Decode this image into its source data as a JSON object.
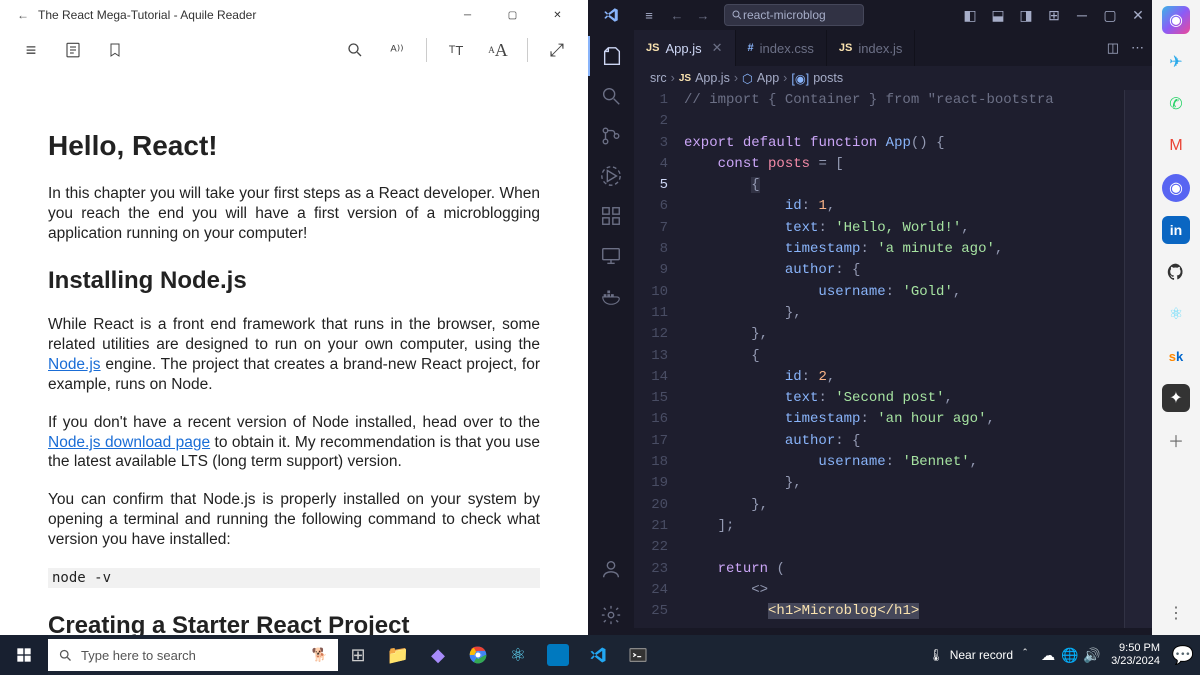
{
  "reader": {
    "title": "The React Mega-Tutorial - Aquile Reader",
    "h1": "Hello, React!",
    "p1": "In this chapter you will take your first steps as a React developer. When you reach the end you will have a first version of a microblogging application running on your computer!",
    "h2a": "Installing Node.js",
    "p2a": "While React is a front end framework that runs in the browser, some related utilities are designed to run on your own computer, using the ",
    "link1": "Node.js",
    "p2b": " engine. The project that creates a brand-new React project, for example, runs on Node.",
    "p3a": "If you don't have a recent version of Node installed, head over to the ",
    "link2": "Node.js download page",
    "p3b": " to obtain it. My recommendation is that you use the latest available LTS (long term support) version.",
    "p4": "You can confirm that Node.js is properly installed on your system by opening a terminal and running the following command to check what version you have installed:",
    "cmd": "node -v",
    "h2b": "Creating a Starter React Project"
  },
  "vscode": {
    "search_text": "react-microblog",
    "tabs": [
      {
        "icon": "JS",
        "label": "App.js",
        "active": true
      },
      {
        "icon": "#",
        "label": "index.css",
        "active": false
      },
      {
        "icon": "JS",
        "label": "index.js",
        "active": false
      }
    ],
    "crumbs": {
      "a": "src",
      "b": "App.js",
      "c": "App",
      "d": "posts"
    },
    "lines": [
      "1",
      "2",
      "3",
      "4",
      "5",
      "6",
      "7",
      "8",
      "9",
      "10",
      "11",
      "12",
      "13",
      "14",
      "15",
      "16",
      "17",
      "18",
      "19",
      "20",
      "21",
      "22",
      "23",
      "24",
      "25"
    ],
    "code": {
      "l1": "// import { Container } from \"react-bootstra",
      "l3a": "export",
      "l3b": "default",
      "l3c": "function",
      "l3d": "App",
      "l3e": "() {",
      "l4a": "const",
      "l4b": "posts",
      "l4c": "= [",
      "l5": "{",
      "l6a": "id",
      "l6b": ":",
      "l6c": "1",
      "l6d": ",",
      "l7a": "text",
      "l7b": ":",
      "l7c": "'Hello, World!'",
      "l7d": ",",
      "l8a": "timestamp",
      "l8b": ":",
      "l8c": "'a minute ago'",
      "l8d": ",",
      "l9a": "author",
      "l9b": ": {",
      "l10a": "username",
      "l10b": ":",
      "l10c": "'Gold'",
      "l10d": ",",
      "l11": "},",
      "l12": "},",
      "l13": "{",
      "l14a": "id",
      "l14b": ":",
      "l14c": "2",
      "l14d": ",",
      "l15a": "text",
      "l15b": ":",
      "l15c": "'Second post'",
      "l15d": ",",
      "l16a": "timestamp",
      "l16b": ":",
      "l16c": "'an hour ago'",
      "l16d": ",",
      "l17a": "author",
      "l17b": ": {",
      "l18a": "username",
      "l18b": ":",
      "l18c": "'Bennet'",
      "l18d": ",",
      "l19": "},",
      "l20": "},",
      "l21": "];",
      "l23a": "return",
      "l23b": "(",
      "l24": "<>",
      "l25": "<h1>Microblog</h1>"
    }
  },
  "taskbar": {
    "search_placeholder": "Type here to search",
    "weather": "Near record",
    "time": "9:50 PM",
    "date": "3/23/2024"
  },
  "rail": {
    "sk": "sk"
  }
}
